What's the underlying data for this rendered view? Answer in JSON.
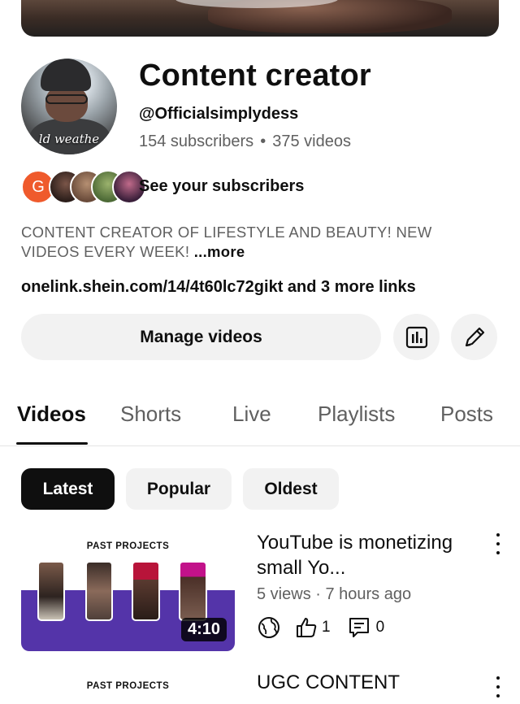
{
  "channel": {
    "name": "Content creator",
    "handle": "@Officialsimplydess",
    "subscribers": "154 subscribers",
    "separator": "•",
    "video_count": "375 videos",
    "avatar_caption": "ld weathe",
    "subscribers_link": "See your subscribers",
    "subscriber_initial": "G",
    "description": "CONTENT CREATOR OF LIFESTYLE AND BEAUTY! NEW VIDEOS EVERY WEEK!",
    "description_more": "...more",
    "links": "onelink.shein.com/14/4t60lc72gikt and 3 more links"
  },
  "actions": {
    "manage_videos": "Manage videos",
    "analytics_icon": "analytics-icon",
    "edit_icon": "pencil-icon"
  },
  "tabs": [
    "Videos",
    "Shorts",
    "Live",
    "Playlists",
    "Posts"
  ],
  "active_tab": "Videos",
  "filters": [
    "Latest",
    "Popular",
    "Oldest"
  ],
  "active_filter": "Latest",
  "videos": [
    {
      "thumbnail_label": "PAST PROJECTS",
      "duration": "4:10",
      "title": "YouTube is monetizing small Yo...",
      "meta": "5 views · 7 hours ago",
      "likes": "1",
      "comments": "0",
      "visibility_icon": "globe-icon"
    },
    {
      "thumbnail_label": "PAST PROJECTS",
      "title": "UGC CONTENT"
    }
  ],
  "colors": {
    "accent_dark": "#0f0f0f",
    "secondary_text": "#606060",
    "chip_bg": "#f2f2f2",
    "thumbnail_band": "#5434a9",
    "subscriber_badge": "#ef5a2c"
  }
}
